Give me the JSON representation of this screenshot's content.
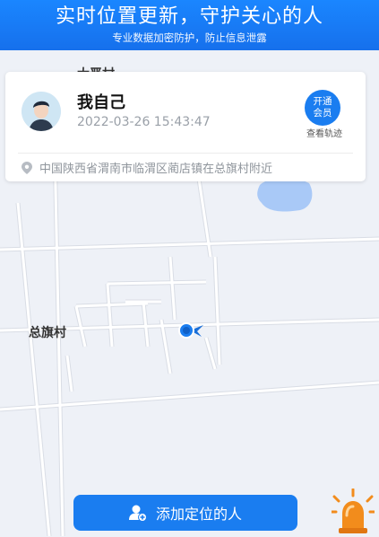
{
  "banner": {
    "title": "实时位置更新，守护关心的人",
    "subtitle": "专业数据加密防护，防止信息泄露"
  },
  "map": {
    "village_label": "总旗村",
    "village_label_top": "大晋村"
  },
  "card": {
    "name": "我自己",
    "timestamp": "2022-03-26 15:43:47",
    "vip_line1": "开通",
    "vip_line2": "会员",
    "track_label": "查看轨迹",
    "address": "中国陕西省渭南市临渭区蔺店镇在总旗村附近"
  },
  "action": {
    "add_label": "添加定位的人"
  },
  "colors": {
    "brand_blue": "#1a7df0",
    "alarm_orange": "#f28c1c"
  }
}
